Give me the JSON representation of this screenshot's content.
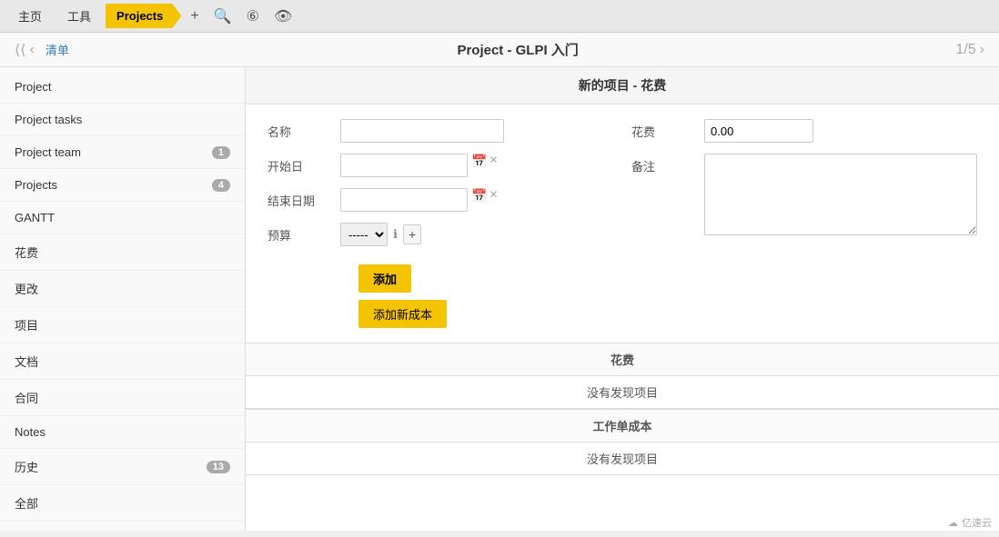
{
  "topnav": {
    "home": "主页",
    "tools": "工具",
    "projects": "Projects",
    "icons": {
      "plus": "+",
      "search": "🔍",
      "branches": "⑥",
      "eye": "👁"
    }
  },
  "header": {
    "nav_first": "⟨⟨",
    "nav_prev": "‹",
    "breadcrumb": "清单",
    "title": "Project - GLPI 入门",
    "page": "1/5",
    "nav_next": "›"
  },
  "sidebar": {
    "items": [
      {
        "id": "project",
        "label": "Project",
        "badge": null
      },
      {
        "id": "project-tasks",
        "label": "Project tasks",
        "badge": null
      },
      {
        "id": "project-team",
        "label": "Project team",
        "badge": "1"
      },
      {
        "id": "projects",
        "label": "Projects",
        "badge": "4"
      },
      {
        "id": "gantt",
        "label": "GANTT",
        "badge": null
      },
      {
        "id": "cost",
        "label": "花费",
        "badge": null
      },
      {
        "id": "change",
        "label": "更改",
        "badge": null
      },
      {
        "id": "items",
        "label": "项目",
        "badge": null
      },
      {
        "id": "document",
        "label": "文档",
        "badge": null
      },
      {
        "id": "contract",
        "label": "合同",
        "badge": null
      },
      {
        "id": "notes",
        "label": "Notes",
        "badge": null
      },
      {
        "id": "history",
        "label": "历史",
        "badge": "13"
      },
      {
        "id": "all",
        "label": "全部",
        "badge": null
      }
    ]
  },
  "form": {
    "header": "新的项目 - 花费",
    "name_label": "名称",
    "name_placeholder": "",
    "cost_label": "花费",
    "cost_value": "0.00",
    "start_date_label": "开始日",
    "end_date_label": "结束日期",
    "remark_label": "备注",
    "budget_label": "预算",
    "budget_option": "-----",
    "add_button": "添加",
    "add_new_cost_button": "添加新成本",
    "section_cost": "花费",
    "no_items_1": "没有发现项目",
    "section_work_order": "工作单成本",
    "no_items_2": "没有发现项目"
  },
  "watermark": {
    "logo": "☁",
    "text": "亿速云"
  }
}
